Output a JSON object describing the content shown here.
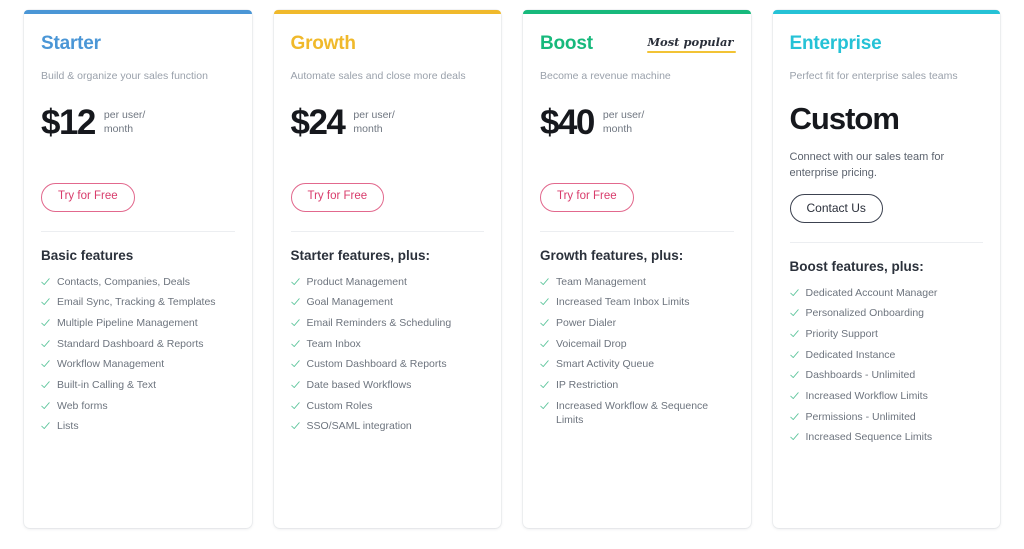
{
  "page": {
    "background": "#ffffff"
  },
  "colors": {
    "starter": "#4a96d6",
    "growth": "#f0b92b",
    "boost": "#17b97c",
    "enterprise": "#25c2d6",
    "check": "#5cc59b",
    "cta_primary": "#d83b6b",
    "badge_underline": "#f2c335"
  },
  "icons": {
    "check": "check-icon"
  },
  "plans": [
    {
      "id": "starter",
      "name": "Starter",
      "accent": "#4a96d6",
      "tagline": "Build & organize your sales function",
      "price": "$12",
      "price_unit": "per user/\nmonth",
      "cta_label": "Try for Free",
      "cta_style": "primary",
      "badge": null,
      "features_title": "Basic features",
      "features": [
        "Contacts, Companies, Deals",
        "Email Sync, Tracking & Templates",
        "Multiple Pipeline Management",
        "Standard Dashboard & Reports",
        "Workflow Management",
        "Built-in Calling & Text",
        "Web forms",
        "Lists"
      ]
    },
    {
      "id": "growth",
      "name": "Growth",
      "accent": "#f0b92b",
      "tagline": "Automate sales and close more deals",
      "price": "$24",
      "price_unit": "per user/\nmonth",
      "cta_label": "Try for Free",
      "cta_style": "primary",
      "badge": null,
      "features_title": "Starter features, plus:",
      "features": [
        "Product Management",
        "Goal Management",
        "Email Reminders & Scheduling",
        "Team Inbox",
        "Custom Dashboard & Reports",
        "Date based Workflows",
        "Custom Roles",
        "SSO/SAML integration"
      ]
    },
    {
      "id": "boost",
      "name": "Boost",
      "accent": "#17b97c",
      "tagline": "Become a revenue machine",
      "price": "$40",
      "price_unit": "per user/\nmonth",
      "cta_label": "Try for Free",
      "cta_style": "primary",
      "badge": "Most popular",
      "features_title": "Growth features, plus:",
      "features": [
        "Team Management",
        "Increased Team Inbox Limits",
        "Power Dialer",
        "Voicemail Drop",
        "Smart Activity Queue",
        "IP Restriction",
        "Increased Workflow & Sequence Limits"
      ]
    },
    {
      "id": "enterprise",
      "name": "Enterprise",
      "accent": "#25c2d6",
      "tagline": "Perfect fit for enterprise sales teams",
      "price": "Custom",
      "price_unit": null,
      "enterprise_note": "Connect with our sales team for enterprise pricing.",
      "cta_label": "Contact Us",
      "cta_style": "secondary",
      "badge": null,
      "features_title": "Boost features, plus:",
      "features": [
        "Dedicated Account Manager",
        "Personalized Onboarding",
        "Priority Support",
        "Dedicated Instance",
        "Dashboards - Unlimited",
        "Increased Workflow Limits",
        "Permissions - Unlimited",
        "Increased Sequence Limits"
      ]
    }
  ]
}
